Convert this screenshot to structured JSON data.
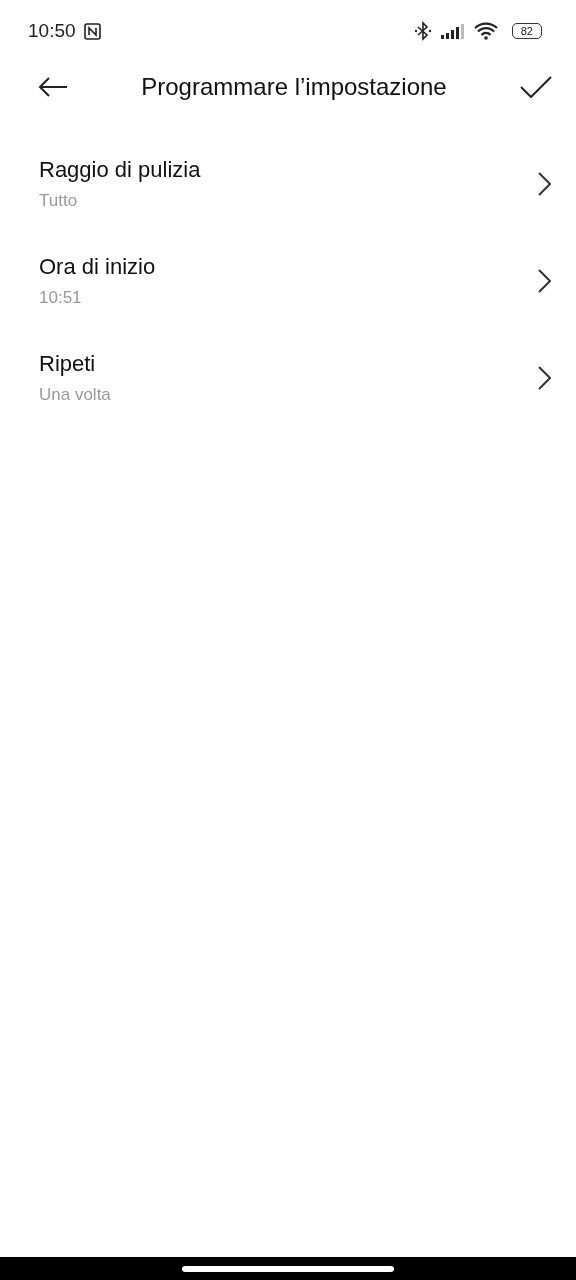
{
  "status_bar": {
    "time": "10:50",
    "battery": "82"
  },
  "header": {
    "title": "Programmare l’impostazione"
  },
  "items": [
    {
      "label": "Raggio di pulizia",
      "value": "Tutto"
    },
    {
      "label": "Ora di inizio",
      "value": "10:51"
    },
    {
      "label": "Ripeti",
      "value": "Una volta"
    }
  ]
}
